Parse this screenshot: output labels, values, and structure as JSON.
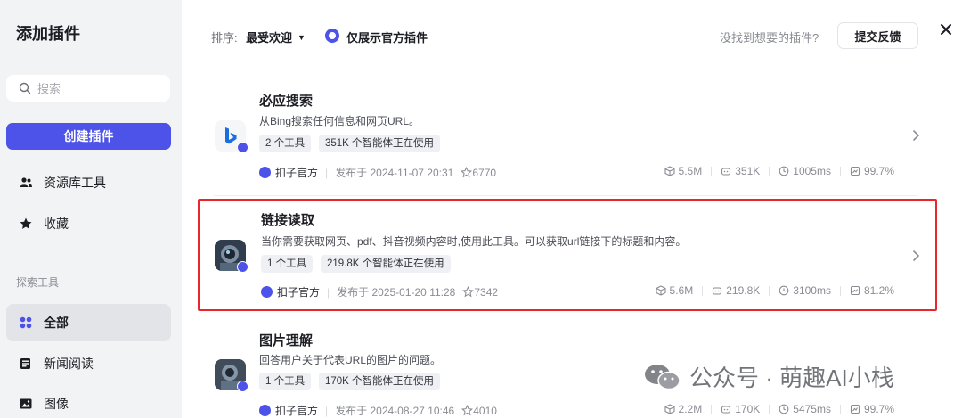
{
  "sidebar": {
    "title": "添加插件",
    "search_placeholder": "搜索",
    "create_label": "创建插件",
    "items": [
      {
        "label": "资源库工具",
        "icon": "people-icon"
      },
      {
        "label": "收藏",
        "icon": "star-icon"
      }
    ],
    "section_label": "探索工具",
    "explore_items": [
      {
        "label": "全部",
        "icon": "grid-icon",
        "active": true
      },
      {
        "label": "新闻阅读",
        "icon": "news-icon"
      },
      {
        "label": "图像",
        "icon": "image-icon"
      }
    ]
  },
  "toolbar": {
    "sort_label": "排序:",
    "sort_value": "最受欢迎",
    "official_only_label": "仅展示官方插件",
    "official_only_checked": true,
    "not_found_text": "没找到想要的插件?",
    "feedback_label": "提交反馈"
  },
  "accent_color": "#4d53e8",
  "highlight_color": "#e8262c",
  "plugins": [
    {
      "name": "必应搜索",
      "description": "从Bing搜索任何信息和网页URL。",
      "tools": "2 个工具",
      "usage": "351K 个智能体正在使用",
      "author": "扣子官方",
      "published": "发布于 2024-11-07 20:31",
      "stars": "6770",
      "calls": "5.5M",
      "bots": "351K",
      "latency": "1005ms",
      "success": "99.7%",
      "icon": "bing-icon",
      "highlighted": false
    },
    {
      "name": "链接读取",
      "description": "当你需要获取网页、pdf、抖音视频内容时,使用此工具。可以获取url链接下的标题和内容。",
      "tools": "1 个工具",
      "usage": "219.8K 个智能体正在使用",
      "author": "扣子官方",
      "published": "发布于 2025-01-20 11:28",
      "stars": "7342",
      "calls": "5.6M",
      "bots": "219.8K",
      "latency": "3100ms",
      "success": "81.2%",
      "icon": "robot-avatar-icon",
      "highlighted": true
    },
    {
      "name": "图片理解",
      "description": "回答用户关于代表URL的图片的问题。",
      "tools": "1 个工具",
      "usage": "170K 个智能体正在使用",
      "author": "扣子官方",
      "published": "发布于 2024-08-27 10:46",
      "stars": "4010",
      "calls": "2.2M",
      "bots": "170K",
      "latency": "5475ms",
      "success": "99.7%",
      "icon": "robot-avatar-icon",
      "highlighted": false
    }
  ],
  "watermark": "公众号 · 萌趣AI小栈"
}
